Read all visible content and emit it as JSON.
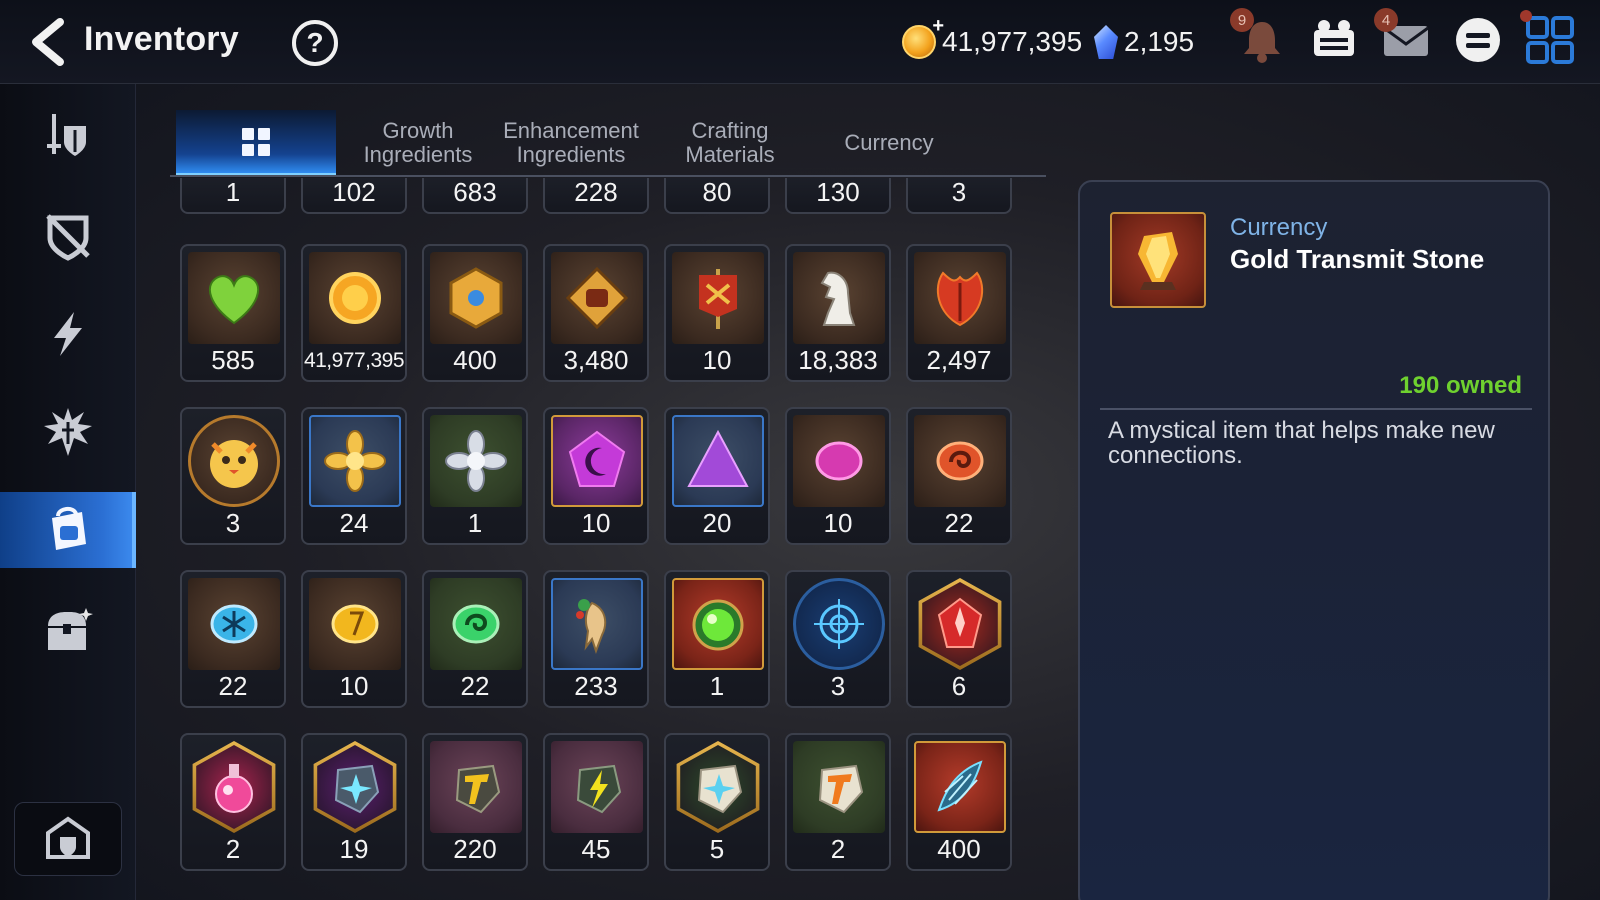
{
  "header": {
    "title": "Inventory",
    "help_label": "?",
    "gold": "41,977,395",
    "skystone": "2,195",
    "notification_badge": "9",
    "mail_badge": "4"
  },
  "colors": {
    "active_tab": "#2f8bf0",
    "owned_text": "#6fd12f",
    "category_text": "#7fb3e6"
  },
  "sidebar": {
    "items": [
      {
        "name": "sidebar-equipment",
        "icon": "sword-shield-icon"
      },
      {
        "name": "sidebar-artifact",
        "icon": "broken-shield-icon"
      },
      {
        "name": "sidebar-skill",
        "icon": "lightning-icon"
      },
      {
        "name": "sidebar-hero",
        "icon": "spiky-figure-icon"
      },
      {
        "name": "sidebar-bag",
        "icon": "backpack-icon",
        "active": true
      },
      {
        "name": "sidebar-chest",
        "icon": "treasure-chest-icon"
      }
    ]
  },
  "tabs": [
    {
      "label": "",
      "icon": "grid-icon",
      "active": true
    },
    {
      "label": "Growth\nIngredients"
    },
    {
      "label": "Enhancement\nIngredients"
    },
    {
      "label": "Crafting\nMaterials"
    },
    {
      "label": "Currency"
    }
  ],
  "partial_row": [
    "1",
    "102",
    "683",
    "228",
    "80",
    "130",
    "3"
  ],
  "items": [
    {
      "count": "585",
      "icon": "green-heart-icon",
      "frame": "brown"
    },
    {
      "count": "41,977,395",
      "icon": "gold-coin-icon",
      "frame": "brown",
      "small": true
    },
    {
      "count": "400",
      "icon": "gold-emblem-icon",
      "frame": "brown"
    },
    {
      "count": "3,480",
      "icon": "fist-badge-icon",
      "frame": "brown"
    },
    {
      "count": "10",
      "icon": "war-banner-icon",
      "frame": "brown"
    },
    {
      "count": "18,383",
      "icon": "knight-chess-icon",
      "frame": "brown"
    },
    {
      "count": "2,497",
      "icon": "red-leaf-icon",
      "frame": "brown"
    },
    {
      "count": "3",
      "icon": "mascot-icon",
      "frame": "round"
    },
    {
      "count": "24",
      "icon": "gold-flower-icon",
      "frame": "blue"
    },
    {
      "count": "1",
      "icon": "silver-flower-icon",
      "frame": "green"
    },
    {
      "count": "10",
      "icon": "purple-moon-gem-icon",
      "frame": "purple"
    },
    {
      "count": "20",
      "icon": "purple-triangle-gem-icon",
      "frame": "blue"
    },
    {
      "count": "10",
      "icon": "pink-moon-rune-icon",
      "frame": "brown"
    },
    {
      "count": "22",
      "icon": "orange-swirl-rune-icon",
      "frame": "brown"
    },
    {
      "count": "22",
      "icon": "ice-rune-icon",
      "frame": "brown"
    },
    {
      "count": "10",
      "icon": "yellow-rune-icon",
      "frame": "brown"
    },
    {
      "count": "22",
      "icon": "green-swirl-rune-icon",
      "frame": "green"
    },
    {
      "count": "233",
      "icon": "ginseng-root-icon",
      "frame": "blue"
    },
    {
      "count": "1",
      "icon": "green-orb-icon",
      "frame": "red"
    },
    {
      "count": "3",
      "icon": "blue-sigil-icon",
      "frame": "round-blue"
    },
    {
      "count": "6",
      "icon": "red-crystal-icon",
      "frame": "hex-red"
    },
    {
      "count": "2",
      "icon": "pink-potion-icon",
      "frame": "hex-pink"
    },
    {
      "count": "19",
      "icon": "purple-stone-icon",
      "frame": "hex-purple"
    },
    {
      "count": "220",
      "icon": "gold-t-stone-icon",
      "frame": "mauve"
    },
    {
      "count": "45",
      "icon": "lightning-stone-icon",
      "frame": "mauve"
    },
    {
      "count": "5",
      "icon": "white-star-stone-icon",
      "frame": "hex-green"
    },
    {
      "count": "2",
      "icon": "orange-t-stone-icon",
      "frame": "green"
    },
    {
      "count": "400",
      "icon": "blue-scale-icon",
      "frame": "red"
    }
  ],
  "detail": {
    "category": "Currency",
    "name": "Gold Transmit Stone",
    "owned": "190 owned",
    "description": "A mystical item that helps make new connections.",
    "icon": "gold-transmit-stone-icon"
  }
}
